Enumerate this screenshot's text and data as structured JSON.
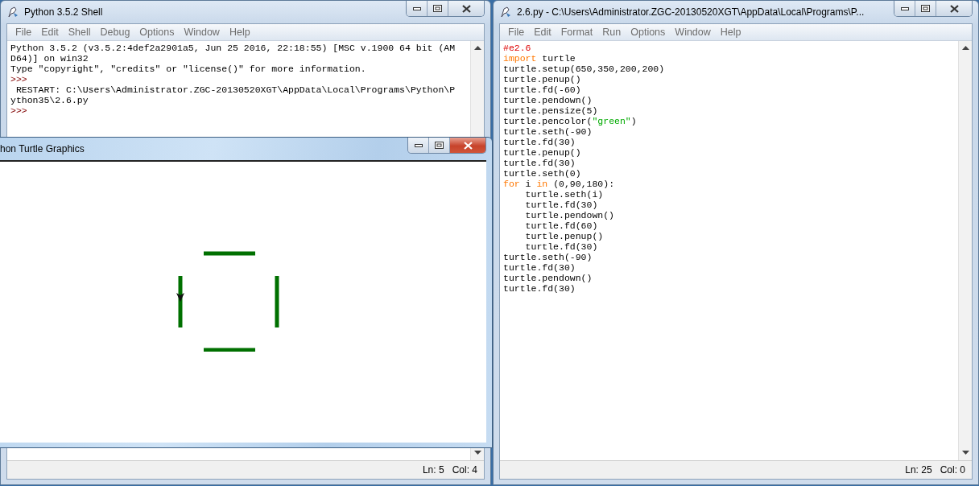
{
  "shell_window": {
    "title": "Python 3.5.2 Shell",
    "active": false,
    "menu": [
      "File",
      "Edit",
      "Shell",
      "Debug",
      "Options",
      "Window",
      "Help"
    ],
    "lines": [
      {
        "kind": "output",
        "text": "Python 3.5.2 (v3.5.2:4def2a2901a5, Jun 25 2016, 22:18:55) [MSC v.1900 64 bit (AM"
      },
      {
        "kind": "output",
        "text": "D64)] on win32"
      },
      {
        "kind": "output",
        "text": "Type \"copyright\", \"credits\" or \"license()\" for more information."
      },
      {
        "kind": "prompt",
        "text": ">>>"
      },
      {
        "kind": "output",
        "text": " RESTART: C:\\Users\\Administrator.ZGC-20130520XGT\\AppData\\Local\\Programs\\Python\\P"
      },
      {
        "kind": "output",
        "text": "ython35\\2.6.py"
      },
      {
        "kind": "prompt",
        "text": ">>>"
      }
    ],
    "status": {
      "line": "Ln: 5",
      "column": "Col: 4"
    }
  },
  "editor_window": {
    "title": "2.6.py - C:\\Users\\Administrator.ZGC-20130520XGT\\AppData\\Local\\Programs\\P...",
    "active": false,
    "menu": [
      "File",
      "Edit",
      "Format",
      "Run",
      "Options",
      "Window",
      "Help"
    ],
    "code": [
      [
        {
          "kind": "comment",
          "text": "#e2.6"
        }
      ],
      [
        {
          "kind": "keyword",
          "text": "import"
        },
        {
          "kind": "plain",
          "text": " turtle"
        }
      ],
      [
        {
          "kind": "plain",
          "text": "turtle.setup(650,350,200,200)"
        }
      ],
      [
        {
          "kind": "plain",
          "text": "turtle.penup()"
        }
      ],
      [
        {
          "kind": "plain",
          "text": "turtle.fd(-60)"
        }
      ],
      [
        {
          "kind": "plain",
          "text": "turtle.pendown()"
        }
      ],
      [
        {
          "kind": "plain",
          "text": "turtle.pensize(5)"
        }
      ],
      [
        {
          "kind": "plain",
          "text": "turtle.pencolor("
        },
        {
          "kind": "string",
          "text": "\"green\""
        },
        {
          "kind": "plain",
          "text": ")"
        }
      ],
      [
        {
          "kind": "plain",
          "text": "turtle.seth(-90)"
        }
      ],
      [
        {
          "kind": "plain",
          "text": "turtle.fd(30)"
        }
      ],
      [
        {
          "kind": "plain",
          "text": "turtle.penup()"
        }
      ],
      [
        {
          "kind": "plain",
          "text": "turtle.fd(30)"
        }
      ],
      [
        {
          "kind": "plain",
          "text": "turtle.seth(0)"
        }
      ],
      [
        {
          "kind": "keyword",
          "text": "for"
        },
        {
          "kind": "plain",
          "text": " i "
        },
        {
          "kind": "keyword",
          "text": "in"
        },
        {
          "kind": "plain",
          "text": " (0,90,180):"
        }
      ],
      [
        {
          "kind": "plain",
          "text": "    turtle.seth(i)"
        }
      ],
      [
        {
          "kind": "plain",
          "text": "    turtle.fd(30)"
        }
      ],
      [
        {
          "kind": "plain",
          "text": "    turtle.pendown()"
        }
      ],
      [
        {
          "kind": "plain",
          "text": "    turtle.fd(60)"
        }
      ],
      [
        {
          "kind": "plain",
          "text": "    turtle.penup()"
        }
      ],
      [
        {
          "kind": "plain",
          "text": "    turtle.fd(30)"
        }
      ],
      [
        {
          "kind": "plain",
          "text": "turtle.seth(-90)"
        }
      ],
      [
        {
          "kind": "plain",
          "text": "turtle.fd(30)"
        }
      ],
      [
        {
          "kind": "plain",
          "text": "turtle.pendown()"
        }
      ],
      [
        {
          "kind": "plain",
          "text": "turtle.fd(30)"
        }
      ]
    ],
    "status": {
      "line": "Ln: 25",
      "column": "Col: 0"
    }
  },
  "turtle_window": {
    "title": "hon Turtle Graphics",
    "active": true
  }
}
